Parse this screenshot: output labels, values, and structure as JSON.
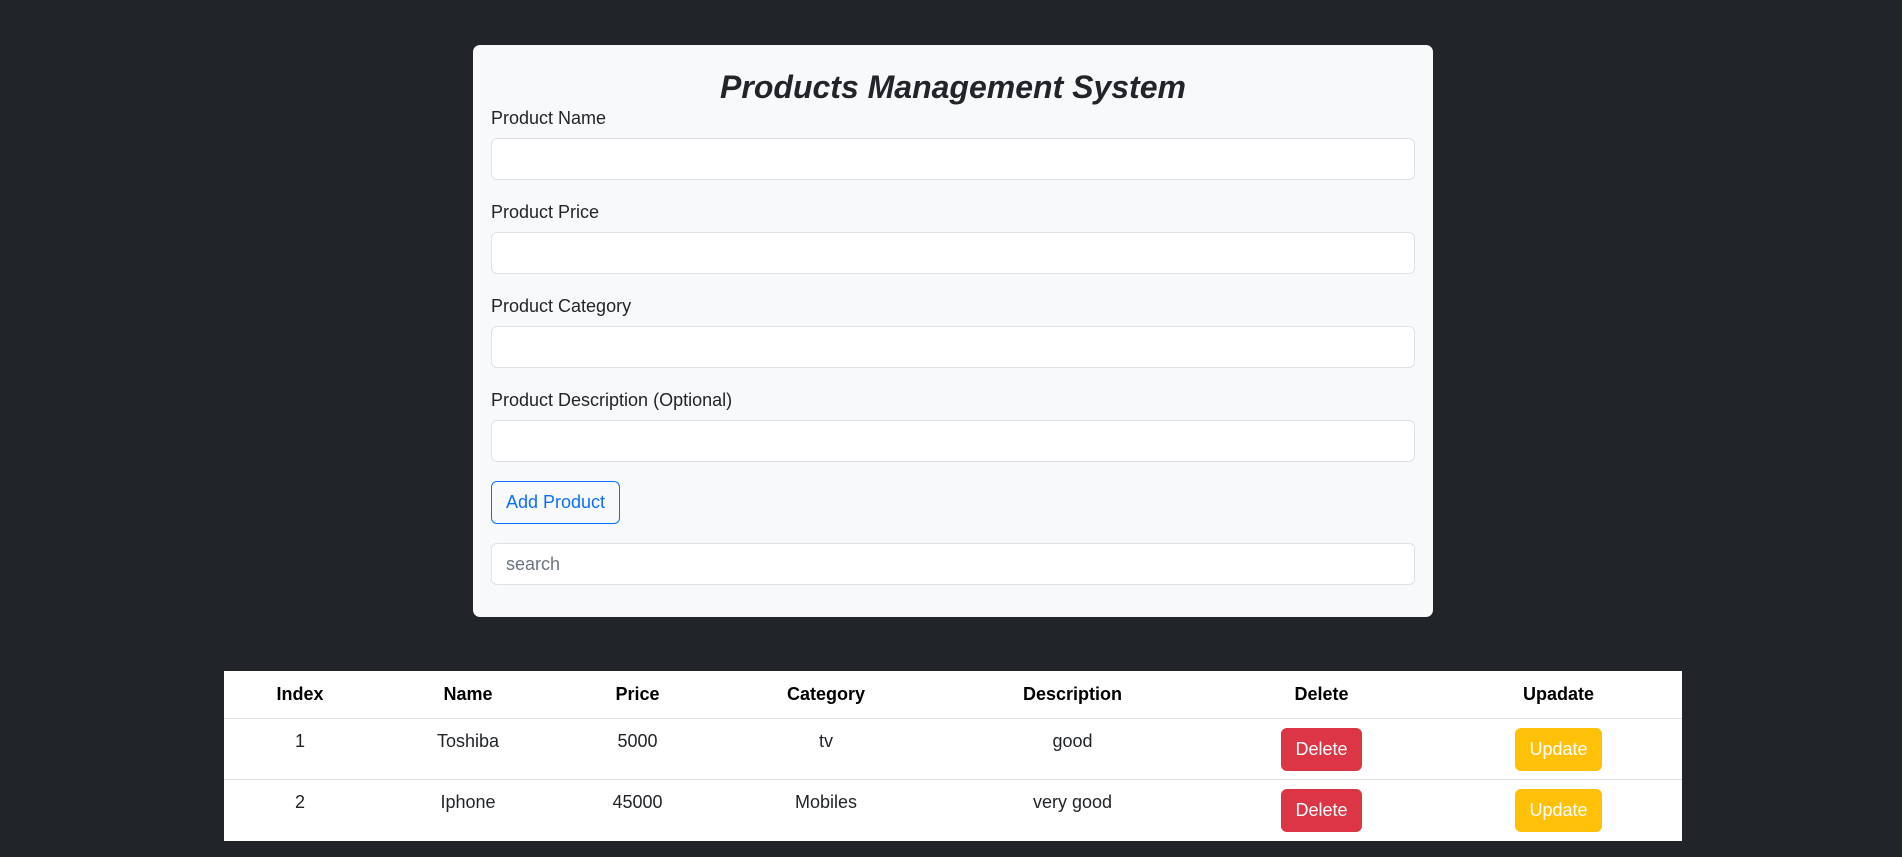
{
  "form": {
    "title": "Products Management System",
    "fields": [
      {
        "label": "Product Name",
        "value": "",
        "placeholder": ""
      },
      {
        "label": "Product Price",
        "value": "",
        "placeholder": ""
      },
      {
        "label": "Product Category",
        "value": "",
        "placeholder": ""
      },
      {
        "label": "Product Description (Optional)",
        "value": "",
        "placeholder": ""
      }
    ],
    "add_button": "Add Product",
    "search": {
      "placeholder": "search",
      "value": ""
    }
  },
  "table": {
    "headers": [
      "Index",
      "Name",
      "Price",
      "Category",
      "Description",
      "Delete",
      "Upadate"
    ],
    "rows": [
      {
        "index": "1",
        "name": "Toshiba",
        "price": "5000",
        "category": "tv",
        "description": "good",
        "delete_label": "Delete",
        "update_label": "Update"
      },
      {
        "index": "2",
        "name": "Iphone",
        "price": "45000",
        "category": "Mobiles",
        "description": "very good",
        "delete_label": "Delete",
        "update_label": "Update"
      }
    ]
  },
  "colors": {
    "page_background": "#212529",
    "card_background": "#f8f9fa",
    "primary": "#0d6efd",
    "danger": "#dc3545",
    "warning": "#ffc107"
  }
}
